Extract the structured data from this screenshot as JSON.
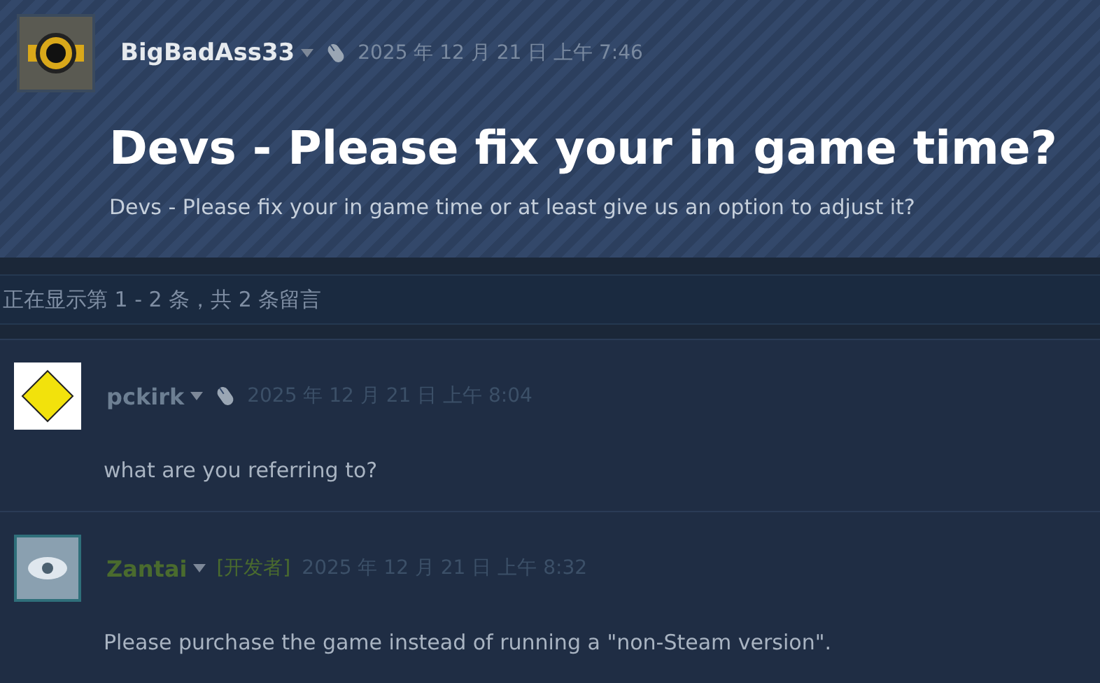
{
  "post": {
    "author": "BigBadAss33",
    "date": "2025 年 12 月 21 日 上午 7:46",
    "title": "Devs - Please fix your in game time?",
    "body": "Devs - Please fix your in game time or at least give us an option to adjust it?"
  },
  "count_text": "正在显示第 1 - 2 条，共 2 条留言",
  "comments": [
    {
      "author": "pckirk",
      "developer": false,
      "date": "2025 年 12 月 21 日 上午 8:04",
      "body": "what are you referring to?"
    },
    {
      "author": "Zantai",
      "developer": true,
      "badge": "[开发者]",
      "date": "2025 年 12 月 21 日 上午 8:32",
      "body": "Please purchase the game instead of running a \"non-Steam version\"."
    }
  ]
}
